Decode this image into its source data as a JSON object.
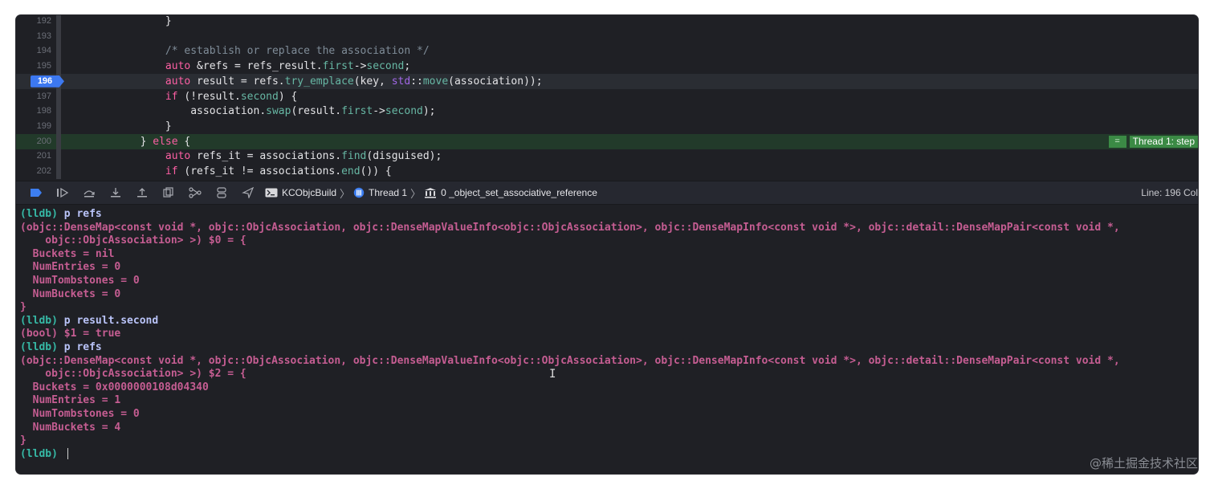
{
  "editor": {
    "lines": [
      {
        "num": "192",
        "tokens": [
          [
            "plain",
            "            }"
          ]
        ]
      },
      {
        "num": "193",
        "tokens": []
      },
      {
        "num": "194",
        "tokens": [
          [
            "comment",
            "            /* establish or replace the association */"
          ]
        ]
      },
      {
        "num": "195",
        "tokens": [
          [
            "kw",
            "            auto"
          ],
          [
            "plain",
            " &refs = refs_result."
          ],
          [
            "member",
            "first"
          ],
          [
            "plain",
            "->"
          ],
          [
            "member",
            "second"
          ],
          [
            "plain",
            ";"
          ]
        ]
      },
      {
        "num": "196",
        "breakpoint": true,
        "current": true,
        "tokens": [
          [
            "kw",
            "            auto"
          ],
          [
            "plain",
            " result = refs."
          ],
          [
            "func",
            "try_emplace"
          ],
          [
            "plain",
            "(key, "
          ],
          [
            "ns",
            "std"
          ],
          [
            "plain",
            "::"
          ],
          [
            "func",
            "move"
          ],
          [
            "plain",
            "(association));"
          ]
        ]
      },
      {
        "num": "197",
        "tokens": [
          [
            "kw",
            "            if"
          ],
          [
            "plain",
            " (!result."
          ],
          [
            "member",
            "second"
          ],
          [
            "plain",
            ") {"
          ]
        ]
      },
      {
        "num": "198",
        "tokens": [
          [
            "plain",
            "                association."
          ],
          [
            "func",
            "swap"
          ],
          [
            "plain",
            "(result."
          ],
          [
            "member",
            "first"
          ],
          [
            "plain",
            "->"
          ],
          [
            "member",
            "second"
          ],
          [
            "plain",
            ");"
          ]
        ]
      },
      {
        "num": "199",
        "tokens": [
          [
            "plain",
            "            }"
          ]
        ]
      },
      {
        "num": "200",
        "stepped": true,
        "tokens": [
          [
            "plain",
            "        } "
          ],
          [
            "kw",
            "else"
          ],
          [
            "plain",
            " {"
          ]
        ]
      },
      {
        "num": "201",
        "tokens": [
          [
            "kw",
            "            auto"
          ],
          [
            "plain",
            " refs_it = associations."
          ],
          [
            "func",
            "find"
          ],
          [
            "plain",
            "(disguised);"
          ]
        ]
      },
      {
        "num": "202",
        "tokens": [
          [
            "kw",
            "            if"
          ],
          [
            "plain",
            " (refs_it != associations."
          ],
          [
            "func",
            "end"
          ],
          [
            "plain",
            "()) {"
          ]
        ]
      }
    ],
    "thread_badge": {
      "eq": "=",
      "label": "Thread 1: step"
    }
  },
  "debug_bar": {
    "breadcrumbs": [
      {
        "icon": "terminal-icon",
        "label": "KCObjcBuild"
      },
      {
        "icon": "thread-icon",
        "label": "Thread 1"
      },
      {
        "icon": "stack-frame-icon",
        "label": "0 _object_set_associative_reference"
      }
    ],
    "position": "Line: 196  Col"
  },
  "console": {
    "lines": [
      {
        "kind": "cmd",
        "prompt": "(lldb)",
        "text": " p refs"
      },
      {
        "kind": "out",
        "text": "(objc::DenseMap<const void *, objc::ObjcAssociation, objc::DenseMapValueInfo<objc::ObjcAssociation>, objc::DenseMapInfo<const void *>, objc::detail::DenseMapPair<const void *,"
      },
      {
        "kind": "out",
        "text": "    objc::ObjcAssociation> >) $0 = {"
      },
      {
        "kind": "out",
        "text": "  Buckets = nil"
      },
      {
        "kind": "out",
        "text": "  NumEntries = 0"
      },
      {
        "kind": "out",
        "text": "  NumTombstones = 0"
      },
      {
        "kind": "out",
        "text": "  NumBuckets = 0"
      },
      {
        "kind": "out",
        "text": "}"
      },
      {
        "kind": "cmd",
        "prompt": "(lldb)",
        "text": " p result.second"
      },
      {
        "kind": "out",
        "text": "(bool) $1 = true"
      },
      {
        "kind": "cmd",
        "prompt": "(lldb)",
        "text": " p refs"
      },
      {
        "kind": "out",
        "text": "(objc::DenseMap<const void *, objc::ObjcAssociation, objc::DenseMapValueInfo<objc::ObjcAssociation>, objc::DenseMapInfo<const void *>, objc::detail::DenseMapPair<const void *,"
      },
      {
        "kind": "out",
        "text": "    objc::ObjcAssociation> >) $2 = {"
      },
      {
        "kind": "out",
        "text": "  Buckets = 0x0000000108d04340"
      },
      {
        "kind": "out",
        "text": "  NumEntries = 1"
      },
      {
        "kind": "out",
        "text": "  NumTombstones = 0"
      },
      {
        "kind": "out",
        "text": "  NumBuckets = 4"
      },
      {
        "kind": "out",
        "text": "}"
      },
      {
        "kind": "cmd",
        "prompt": "(lldb)",
        "text": " ",
        "cursor": true
      }
    ]
  },
  "watermark": "@稀土掘金技术社区",
  "colors": {
    "keyword": "#fc5fa3",
    "member": "#67b7a4",
    "namespace": "#a167e6",
    "comment": "#7f8c98",
    "console_output": "#c55d92",
    "console_prompt": "#36b9a6",
    "console_command": "#b9c3f8",
    "breakpoint": "#3c78f0",
    "thread_indicator": "#3b8a45"
  }
}
